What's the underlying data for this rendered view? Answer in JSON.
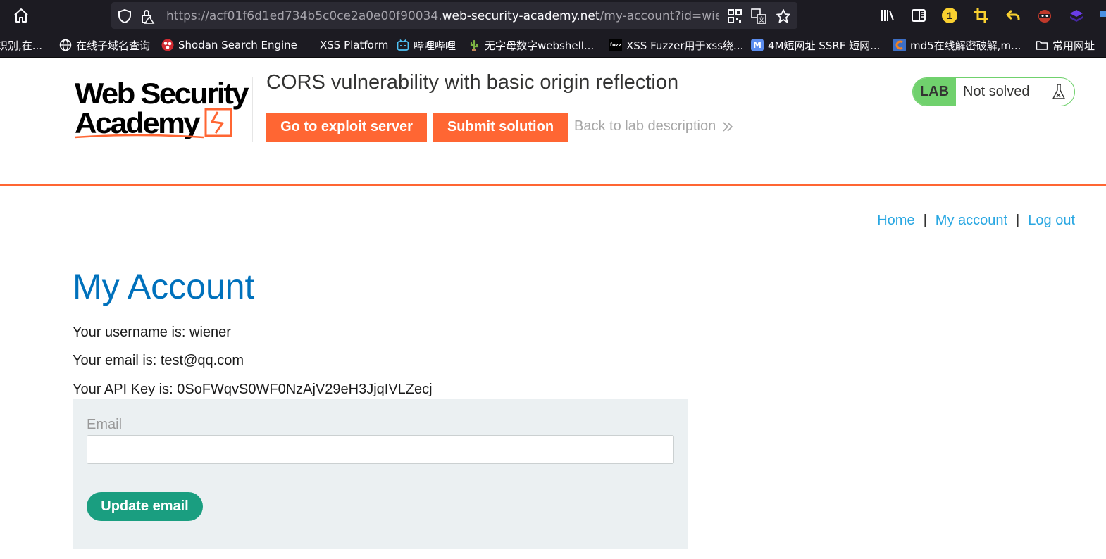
{
  "browser": {
    "url_prefix": "https://acf01f6d1ed734b5c0ce2a0e00f90034.",
    "url_domain": "web-security-academy.net",
    "url_path": "/my-account?id=wiener",
    "notification_count": "1"
  },
  "bookmarks": [
    {
      "label": "识别,在...",
      "icon": "cut-off-icon"
    },
    {
      "label": "在线子域名查询",
      "icon": "globe-icon"
    },
    {
      "label": "Shodan Search Engine",
      "icon": "shodan-icon"
    },
    {
      "label": "XSS Platform",
      "icon": "blank-icon"
    },
    {
      "label": "哔哩哔哩",
      "icon": "bilibili-icon"
    },
    {
      "label": "无字母数字webshell...",
      "icon": "cactus-icon"
    },
    {
      "label": "XSS Fuzzer用于xss绕...",
      "icon": "fuzz-icon",
      "icon_text": "fuzz"
    },
    {
      "label": "4M短网址 SSRF  短网...",
      "icon": "m-icon",
      "icon_text": "M"
    },
    {
      "label": "md5在线解密破解,m...",
      "icon": "c-icon"
    },
    {
      "label": "常用网址",
      "icon": "folder-icon"
    }
  ],
  "lab": {
    "logo_line1": "Web Security",
    "logo_line2": "Academy",
    "title": "CORS vulnerability with basic origin reflection",
    "exploit_button": "Go to exploit server",
    "submit_button": "Submit solution",
    "back_link": "Back to lab description",
    "badge_label": "LAB",
    "status": "Not solved",
    "colors": {
      "accent": "#ff6633",
      "badge": "#70d16d"
    }
  },
  "nav": {
    "home": "Home",
    "separator": "|",
    "my_account": "My account",
    "log_out": "Log out"
  },
  "account": {
    "heading": "My Account",
    "username_line": "Your username is: wiener",
    "email_line": "Your email is: test@qq.com",
    "apikey_line": "Your API Key is: 0SoFWqvS0WF0NzAjV29eH3JjqIVLZecj"
  },
  "form": {
    "email_label": "Email",
    "email_value": "",
    "update_button": "Update email"
  }
}
